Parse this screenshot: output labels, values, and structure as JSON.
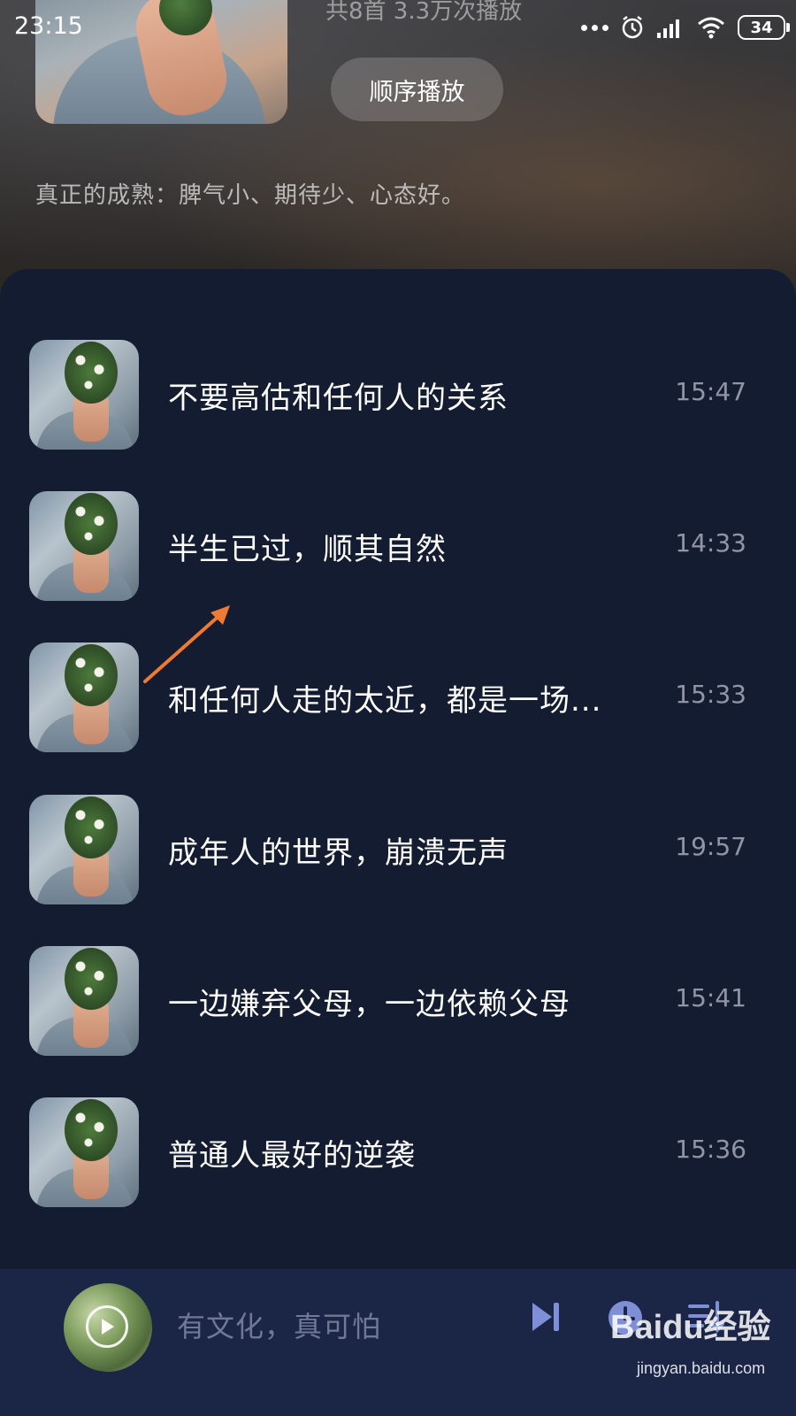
{
  "status_bar": {
    "time": "23:15",
    "battery": "34",
    "icons": [
      "more-dots-icon",
      "alarm-icon",
      "signal-icon",
      "wifi-icon",
      "battery-icon"
    ]
  },
  "album": {
    "meta_partial": "共8首 3.3万次播放",
    "play_mode_label": "顺序播放",
    "description": "真正的成熟：脾气小、期待少、心态好。"
  },
  "tracks": [
    {
      "title": "不要高估和任何人的关系",
      "duration": "15:47"
    },
    {
      "title": "半生已过，顺其自然",
      "duration": "14:33"
    },
    {
      "title": "和任何人走的太近，都是一场...",
      "duration": "15:33"
    },
    {
      "title": "成年人的世界，崩溃无声",
      "duration": "19:57"
    },
    {
      "title": "一边嫌弃父母，一边依赖父母",
      "duration": "15:41"
    },
    {
      "title": "普通人最好的逆袭",
      "duration": "15:36"
    }
  ],
  "mini_player": {
    "now_playing": "有文化，真可怕",
    "controls": [
      "next-icon",
      "timer-icon",
      "playlist-icon"
    ]
  },
  "watermark": {
    "logo": "Baidu经验",
    "url": "jingyan.baidu.com"
  },
  "colors": {
    "panel_bg": "#141c32",
    "mini_player_bg": "#1b2545",
    "control_icon": "#7e8fd8",
    "annotation_arrow": "#f07a2f"
  }
}
